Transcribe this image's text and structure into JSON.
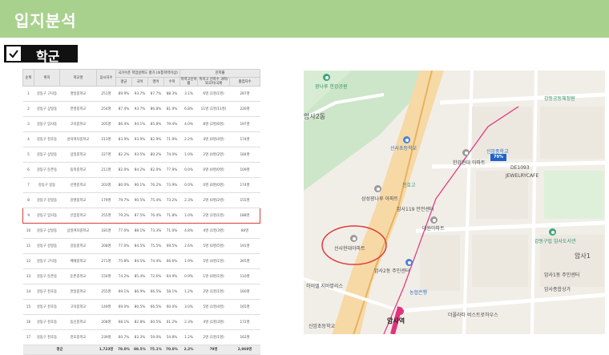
{
  "header": {
    "title": "입지분석"
  },
  "section": {
    "label": "학군"
  },
  "table": {
    "group_headers": [
      "국가수준 학업성취도 평가 (보통학력이상)",
      "진학률"
    ],
    "columns": [
      "순위",
      "위치",
      "학교명",
      "응시자수",
      "평균",
      "국어",
      "영어",
      "수학",
      "학력고진학률",
      "특목고 진학수 과학/외국어/국제",
      "졸업자수"
    ],
    "rows": [
      [
        "1",
        "강동구 고덕동",
        "명일중학교",
        "251명",
        "89.9%",
        "93.7%",
        "87.7%",
        "88.3%",
        "3.1%",
        "6명 (1명/1명)",
        "287명"
      ],
      [
        "2",
        "강동구 상일동",
        "한영중학교",
        "254명",
        "87.4%",
        "93.7%",
        "86.8%",
        "81.9%",
        "6.8%",
        "11명 (1명/11명)",
        "220명"
      ],
      [
        "3",
        "강동구 암사동",
        "고덕중학교",
        "205명",
        "86.4%",
        "94.1%",
        "85.8%",
        "79.4%",
        "4.0%",
        "8명 (2명/6명)",
        "197명"
      ],
      [
        "4",
        "강동구 천호동",
        "성덕여자중학교",
        "213명",
        "83.9%",
        "93.9%",
        "82.9%",
        "71.9%",
        "2.2%",
        "4명 (0명/4명)",
        "174명"
      ],
      [
        "5",
        "강동구 상일동",
        "상일중학교",
        "227명",
        "82.2%",
        "93.5%",
        "80.2%",
        "74.0%",
        "1.0%",
        "2명 (0명/2명)",
        "184명"
      ],
      [
        "6",
        "강동구 둔촌동",
        "동북중학교",
        "211명",
        "82.0%",
        "84.2%",
        "82.0%",
        "77.9%",
        "0.0%",
        "0명 (0명/0명)",
        "109명"
      ],
      [
        "7",
        "강동구 길동",
        "신명중학교",
        "203명",
        "80.0%",
        "90.1%",
        "76.2%",
        "73.9%",
        "0.0%",
        "0명 (0명/0명)",
        "174명"
      ],
      [
        "8",
        "강동구 강일동",
        "강명중학교",
        "179명",
        "79.7%",
        "90.5%",
        "75.4%",
        "73.2%",
        "2.3%",
        "2명 (0명/2명)",
        "155명"
      ],
      [
        "9",
        "강동구 암사동",
        "신암중학교",
        "255명",
        "79.2%",
        "87.5%",
        "76.4%",
        "71.8%",
        "1.0%",
        "2명 (1명/1명)",
        "188명"
      ],
      [
        "10",
        "강동구 상일동",
        "상일여자중학교",
        "181명",
        "77.0%",
        "88.1%",
        "73.3%",
        "71.0%",
        "4.8%",
        "4명 (1명/3명)",
        "84명"
      ],
      [
        "11",
        "강동구 강일동",
        "강동중학교",
        "208명",
        "77.0%",
        "84.5%",
        "75.5%",
        "69.5%",
        "2.6%",
        "5명 (0명/5명)",
        "191명"
      ],
      [
        "12",
        "강동구 고덕동",
        "배재중학교",
        "271명",
        "75.8%",
        "84.5%",
        "74.4%",
        "66.6%",
        "1.9%",
        "5명 (4명/1명)",
        "265명"
      ],
      [
        "13",
        "강동구 둔촌동",
        "둔촌중학교",
        "150명",
        "74.2%",
        "85.4%",
        "72.6%",
        "64.9%",
        "0.9%",
        "1명 (0명/1명)",
        "110명"
      ],
      [
        "14",
        "강동구 천호동",
        "천일중학교",
        "255명",
        "69.1%",
        "86.9%",
        "66.5%",
        "58.1%",
        "1.2%",
        "2명 (1명/1명)",
        "160명"
      ],
      [
        "15",
        "강동구 천호동",
        "고덕중학교",
        "149명",
        "69.0%",
        "80.5%",
        "66.5%",
        "60.0%",
        "3.0%",
        "5명 (1명/4명)",
        "165명"
      ],
      [
        "16",
        "강동구 천호동",
        "동신중학교",
        "208명",
        "68.1%",
        "82.8%",
        "60.5%",
        "61.2%",
        "2.3%",
        "4명 (1명/3명)",
        "172명"
      ],
      [
        "17",
        "강동구 천호동",
        "천호중학교",
        "239명",
        "60.7%",
        "83.3%",
        "59.0%",
        "54.8%",
        "1.2%",
        "2명 (1명/1명)",
        "162명"
      ]
    ],
    "highlight_row_index": 8,
    "average": [
      "평균",
      "1,723명",
      "78.0%",
      "88.5%",
      "75.1%",
      "70.0%",
      "2.2%",
      "79명",
      "2,969명"
    ]
  },
  "map": {
    "labels": {
      "park1": "광나루 한강공원",
      "park2": "강동공동체정원",
      "district1": "암사2동",
      "district2": "암사1",
      "school1": "선사초등학교",
      "apt1": "한강현대 아파트",
      "station1": "신암중학교",
      "apt2": "삼성광나루 아파트",
      "cafe": "JEWELRYCAFE",
      "building": "DE1093",
      "school2": "천호고",
      "center1": "암사119 안전센터",
      "apt3": "대원아파트",
      "apt_target": "선사현대아파트",
      "market": "강동구립 암사도서관",
      "center2": "암사2동 주민센터",
      "bank": "농협은행",
      "center3": "암사1동 주민센터",
      "store": "암사종합상가",
      "jamsil": "하이엘 지바깥리스",
      "station_name": "암사역",
      "school3": "신암초등학교",
      "theatre": "더플라타 비스트로하우스",
      "road": "올림픽대로",
      "park3": "암사생태공원",
      "hotel": "신암동",
      "line_label": "8"
    },
    "badge": "79%",
    "colors": {
      "green": "#a9d18e",
      "highlight": "#e03a3a",
      "subway": "#e0337b"
    }
  }
}
